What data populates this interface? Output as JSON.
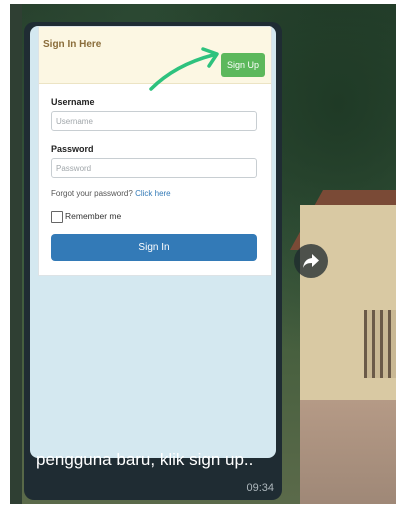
{
  "form": {
    "header_title": "Sign In Here",
    "signup_label": "Sign Up",
    "username_label": "Username",
    "username_placeholder": "Username",
    "username_value": "",
    "password_label": "Password",
    "password_placeholder": "Password",
    "password_value": "",
    "forgot_text": "Forgot your password?",
    "forgot_link": "Click here",
    "remember_label": "Remember me",
    "remember_checked": false,
    "signin_label": "Sign In"
  },
  "message": {
    "caption": "pengguna baru, klik sign up..",
    "time": "09:34"
  },
  "icons": {
    "arrow": "curved-arrow-icon",
    "share": "forward-icon"
  },
  "colors": {
    "signup_green": "#5cb85c",
    "signin_blue": "#337ab7",
    "arrow_green": "#2ec27e",
    "bubble_dark": "#1f2c33"
  }
}
